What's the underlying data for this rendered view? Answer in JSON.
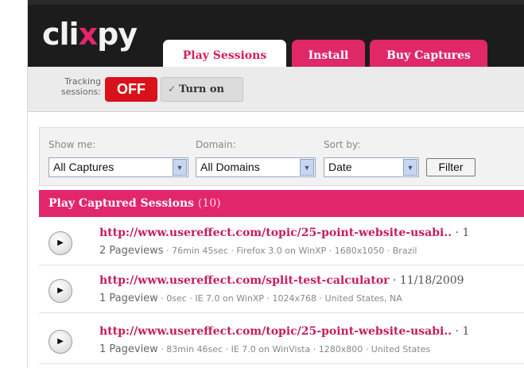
{
  "brand": {
    "logo_left": "cli",
    "logo_x": "x",
    "logo_right": "py"
  },
  "tabs": {
    "play_sessions": "Play Sessions",
    "install": "Install",
    "buy_captures": "Buy Captures"
  },
  "tracking": {
    "label_line1": "Tracking",
    "label_line2": "sessions:",
    "status": "OFF",
    "turn_on_check": "✓",
    "turn_on_label": "Turn on"
  },
  "filters": {
    "show_me_label": "Show me:",
    "show_me_value": "All Captures",
    "domain_label": "Domain:",
    "domain_value": "All Domains",
    "sort_label": "Sort by:",
    "sort_value": "Date",
    "filter_button": "Filter"
  },
  "sessions": {
    "header_title": "Play Captured Sessions",
    "header_count": "(10)",
    "items": [
      {
        "url": "http://www.usereffect.com/topic/25-point-website-usabi..",
        "date": " · 1",
        "pageviews": "2 Pageviews",
        "details": " · 76min 45sec · Firefox 3.0 on WinXP · 1680x1050 · Brazil"
      },
      {
        "url": "http://www.usereffect.com/split-test-calculator",
        "date": " · 11/18/2009",
        "pageviews": "1 Pageview",
        "details": " · 0sec · IE 7.0 on WinXP · 1024x768 · United States, NA"
      },
      {
        "url": "http://www.usereffect.com/topic/25-point-website-usabi..",
        "date": " · 1",
        "pageviews": "1 Pageview",
        "details": " · 83min 46sec · IE 7.0 on WinVista · 1280x800 · United States"
      }
    ]
  },
  "icons": {
    "play": "play-icon",
    "dropdown": "chevron-down-icon",
    "check": "check-icon"
  },
  "colors": {
    "brand_pink": "#e2266b",
    "off_red": "#d8121a",
    "link_pink": "#c51d5b",
    "header_black": "#1c1c1c"
  }
}
